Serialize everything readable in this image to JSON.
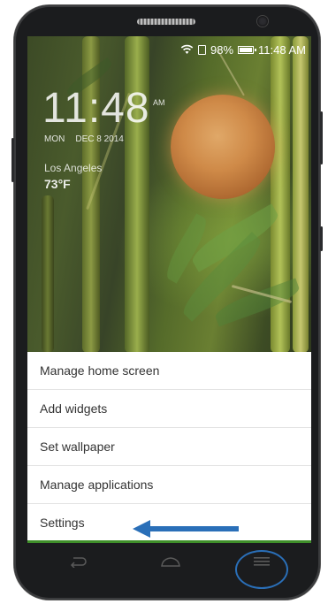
{
  "status_bar": {
    "battery": "98%",
    "time": "11:48 AM"
  },
  "lockclock": {
    "time": "11:48",
    "ampm": "AM",
    "day": "MON",
    "date": "DEC 8 2014",
    "city": "Los Angeles",
    "temperature": "73°F"
  },
  "menu": {
    "items": [
      {
        "label": "Manage home screen"
      },
      {
        "label": "Add widgets"
      },
      {
        "label": "Set wallpaper"
      },
      {
        "label": "Manage applications"
      },
      {
        "label": "Settings"
      }
    ]
  },
  "colors": {
    "annotation": "#2a6fb8",
    "menu_accent": "#3f8f2a"
  },
  "icons": [
    "wifi-icon",
    "sim-icon",
    "battery-icon",
    "back-icon",
    "home-icon",
    "menu-icon"
  ]
}
